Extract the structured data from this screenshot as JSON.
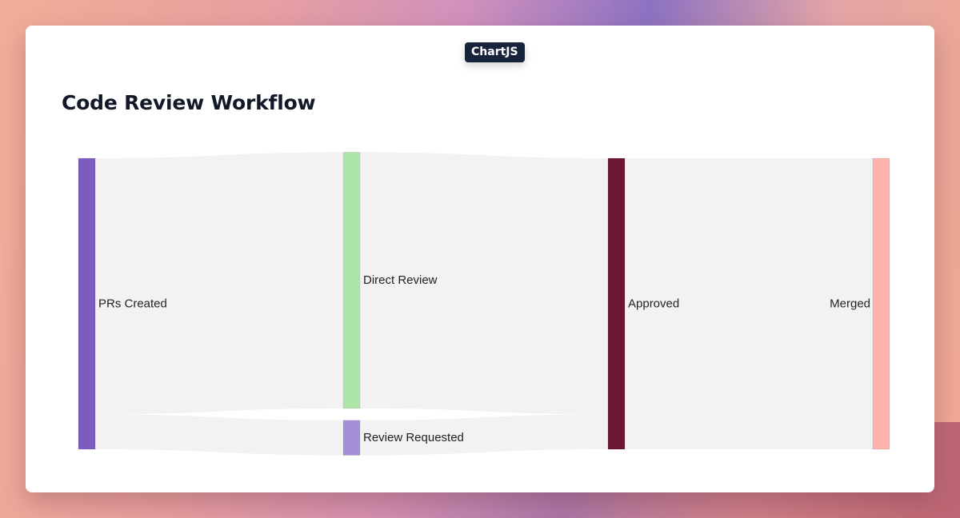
{
  "badge": "ChartJS",
  "chart_data": {
    "type": "sankey",
    "title": "Code Review Workflow",
    "nodes": [
      {
        "id": "prs_created",
        "label": "PRs Created",
        "column": 0,
        "color": "#7c5cbf"
      },
      {
        "id": "direct_review",
        "label": "Direct Review",
        "column": 1,
        "color": "#ade5a8"
      },
      {
        "id": "review_requested",
        "label": "Review Requested",
        "column": 1,
        "color": "#a58fd6"
      },
      {
        "id": "approved",
        "label": "Approved",
        "column": 2,
        "color": "#6b1634"
      },
      {
        "id": "merged",
        "label": "Merged",
        "column": 3,
        "color": "#fbb3ac"
      }
    ],
    "links": [
      {
        "source": "prs_created",
        "target": "direct_review",
        "value": 88
      },
      {
        "source": "prs_created",
        "target": "review_requested",
        "value": 12
      },
      {
        "source": "direct_review",
        "target": "approved",
        "value": 88
      },
      {
        "source": "review_requested",
        "target": "approved",
        "value": 12
      },
      {
        "source": "approved",
        "target": "merged",
        "value": 100
      }
    ],
    "link_color": "#f2f2f2"
  }
}
